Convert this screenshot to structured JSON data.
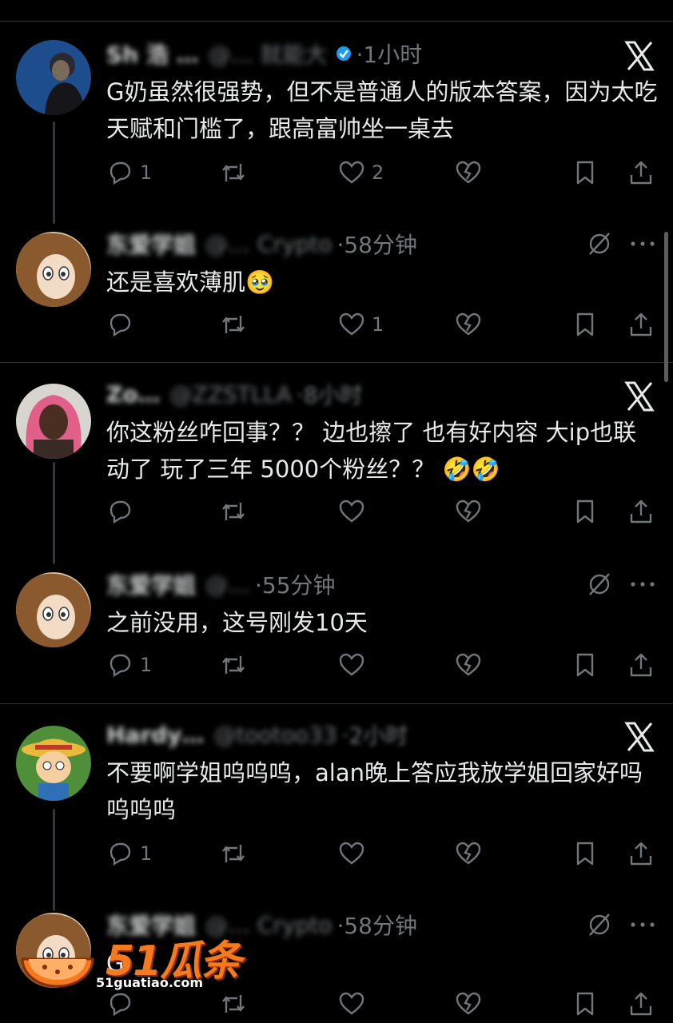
{
  "posts": [
    {
      "name": "Sh 浩 …",
      "handle": "@… 就能大",
      "time": "·1小时",
      "text": "G奶虽然很强势，但不是普通人的版本答案，因为太吃天赋和门槛了，跟高富帅坐一桌去",
      "reply_count": "1",
      "like_count": "2",
      "avatar_color": "#1d4d8c"
    },
    {
      "name": "东爱学姐",
      "handle": "@… Crypto",
      "time": "·58分钟",
      "text": "还是喜欢薄肌🥹",
      "reply_count": "",
      "like_count": "1",
      "avatar_color": "#8a5a2e"
    },
    {
      "name": "Zo… ",
      "handle": "@ZZSTLLA",
      "time": "·8小时",
      "text": "你这粉丝咋回事？？ 边也擦了 也有好内容 大ip也联动了  玩了三年 5000个粉丝？？ 🤣🤣",
      "reply_count": "",
      "like_count": "",
      "avatar_color": "#c05a7a"
    },
    {
      "name": "东爱学姐",
      "handle": "@…",
      "time": "·55分钟",
      "text": "之前没用，这号刚发10天",
      "reply_count": "1",
      "like_count": "",
      "avatar_color": "#8a5a2e"
    },
    {
      "name": "Hardy…",
      "handle": "@tootoo33",
      "time": "·2小时",
      "text": "不要啊学姐呜呜呜，alan晚上答应我放学姐回家好吗呜呜呜",
      "reply_count": "1",
      "like_count": "",
      "avatar_color": "#2e5c2e"
    },
    {
      "name": "东爱学姐",
      "handle": "@… Crypto",
      "time": "·58分钟",
      "text": "G",
      "reply_count": "",
      "like_count": "",
      "avatar_color": "#8a5a2e"
    }
  ],
  "watermark": {
    "brand": "51瓜条",
    "url": "51guatiao.com"
  },
  "colors": {
    "background": "#000000",
    "text": "#e7e9ea",
    "muted": "#71767b",
    "divider": "#2f3336",
    "watermark": "#f57a1f"
  },
  "icons": [
    "reply-icon",
    "retweet-icon",
    "like-icon",
    "grok-icon",
    "bookmark-icon",
    "share-icon",
    "x-logo-icon",
    "mute-icon",
    "more-icon"
  ]
}
